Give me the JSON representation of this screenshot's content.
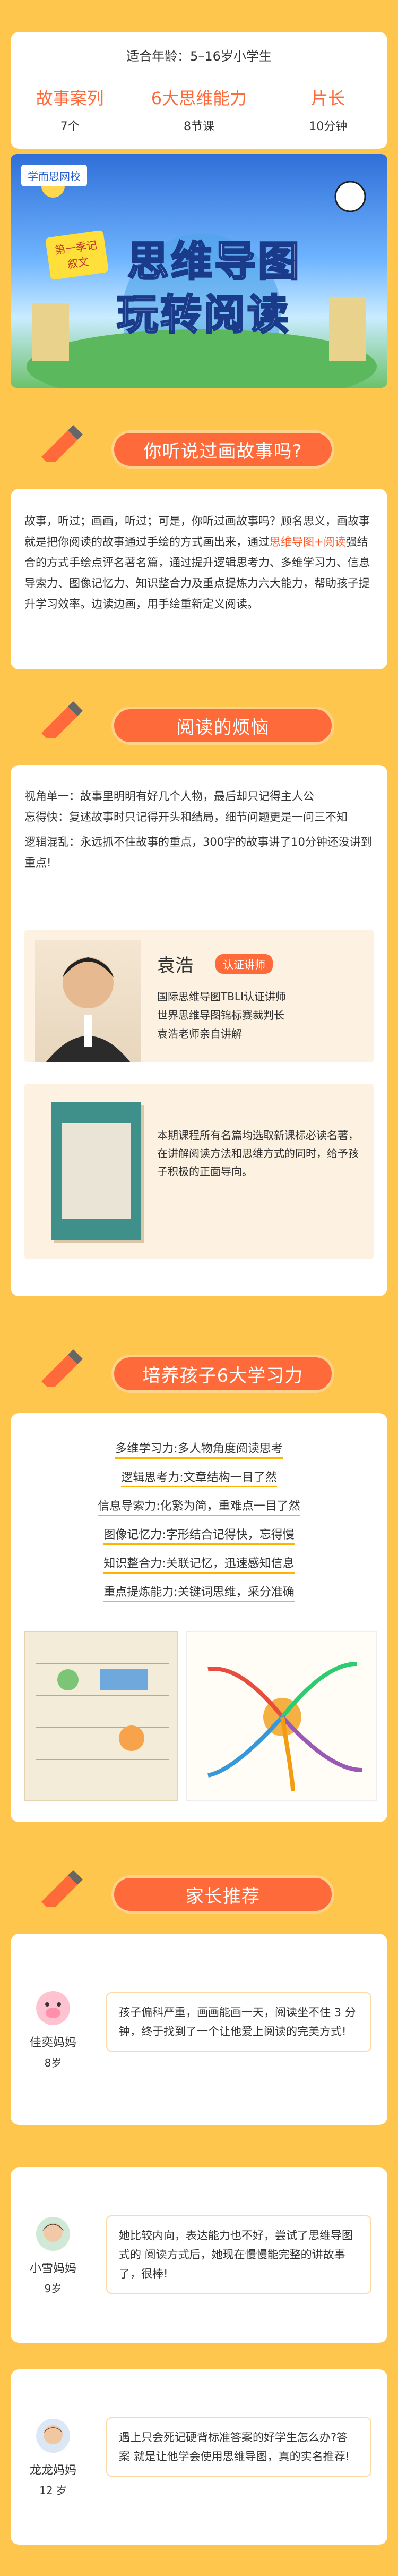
{
  "top": {
    "age_label": "适合年龄：5–16岁小学生",
    "stats": [
      {
        "title": "故事案列",
        "value": "7个"
      },
      {
        "title": "6大思维能力",
        "value": "8节课"
      },
      {
        "title": "片长",
        "value": "10分钟"
      }
    ]
  },
  "banner": {
    "logo": "学而思网校",
    "badge": "第一季记叙文",
    "title_line1": "思维导图",
    "title_line2": "玩转阅读"
  },
  "section1": {
    "title": "你听说过画故事吗?",
    "p1": "故事，听过；画画，听过；可是，你听过画故事吗？顾名思义，画故事就是把你阅读的故事通过手绘的方式画出来，通过",
    "p1_highlight": "思维导图+阅读",
    "p1_rest": "强结合的方式手绘点评名著名篇，通过提升逻辑思考力、多维学习力、信息导索力、图像记忆力、知识整合力及重点提炼力六大能力，帮助孩子提升学习效率。边读边画，用手绘重新定义阅读。"
  },
  "section2": {
    "title": "阅读的烦恼",
    "items": [
      "视角单一：故事里明明有好几个人物，最后却只记得主人公",
      "忘得快：复述故事时只记得开头和结局，细节问题更是一问三不知",
      "逻辑混乱：永远抓不住故事的重点，300字的故事讲了10分钟还没讲到重点!"
    ],
    "teacher": {
      "name": "袁浩",
      "badge": "认证讲师",
      "lines": [
        "国际思维导图TBLI认证讲师",
        "世界思维导图锦标赛裁判长",
        "袁浩老师亲自讲解"
      ]
    },
    "book_text": "本期课程所有名篇均选取新课标必读名著，在讲解阅读方法和思维方式的同时，给予孩子积极的正面导向。"
  },
  "section3": {
    "title": "培养孩子6大学习力",
    "features": [
      "多维学习力:多人物角度阅读思考",
      "逻辑思考力:文章结构一目了然",
      "信息导索力:化繁为简，重难点一目了然",
      "图像记忆力:字形结合记得快，忘得慢",
      "知识整合力:关联记忆，迅速感知信息",
      "重点提炼能力:关键词思维，采分准确"
    ]
  },
  "section4": {
    "title": "家长推荐",
    "reviews": [
      {
        "name": "佳奕妈妈",
        "age": "8岁",
        "text": "孩子偏科严重，画画能画一天，阅读坐不住 3 分钟，终于找到了一个让他爱上阅读的完美方式!"
      },
      {
        "name": "小雪妈妈",
        "age": "9岁",
        "text": "她比较内向，表达能力也不好，尝试了思维导图式的  阅读方式后，她现在慢慢能完整的讲故事了，很棒!"
      },
      {
        "name": "龙龙妈妈",
        "age": "12 岁",
        "text": "遇上只会死记硬背标准答案的好学生怎么办?答案  就是让他学会使用思维导图，真的实名推荐!"
      }
    ]
  },
  "colors": {
    "accent": "#ff6a3a",
    "background": "#ffc64d",
    "highlight": "#ff5a2a"
  }
}
